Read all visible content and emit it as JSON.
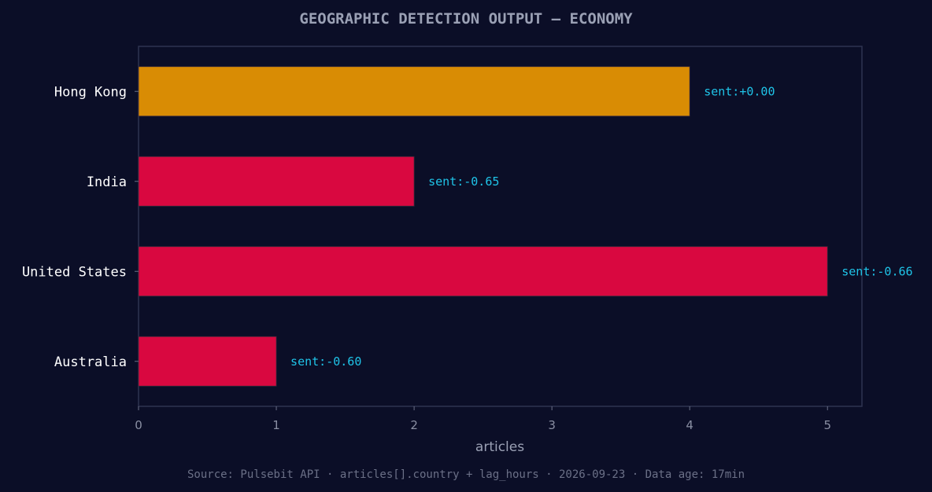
{
  "chart_data": {
    "type": "bar",
    "orientation": "horizontal",
    "title": "GEOGRAPHIC DETECTION OUTPUT — ECONOMY",
    "xlabel": "articles",
    "ylabel": "",
    "xlim": [
      0,
      5.25
    ],
    "xticks": [
      0,
      1,
      2,
      3,
      4,
      5
    ],
    "categories": [
      "Hong Kong",
      "India",
      "United States",
      "Australia"
    ],
    "values": [
      4,
      2,
      5,
      1
    ],
    "data_labels": [
      "sent:+0.00",
      "sent:-0.65",
      "sent:-0.66",
      "sent:-0.60"
    ],
    "bar_colors": [
      "#d98c04",
      "#d90840",
      "#d90840",
      "#d90840"
    ],
    "grid": false,
    "legend": "none"
  },
  "colors": {
    "background": "#0b0e27",
    "frame": "#2e3350",
    "label_accent": "#1fc4e8"
  },
  "footer": {
    "source": "Source: Pulsebit API · articles[].country + lag_hours · 2026-09-23 · Data age: 17min"
  }
}
